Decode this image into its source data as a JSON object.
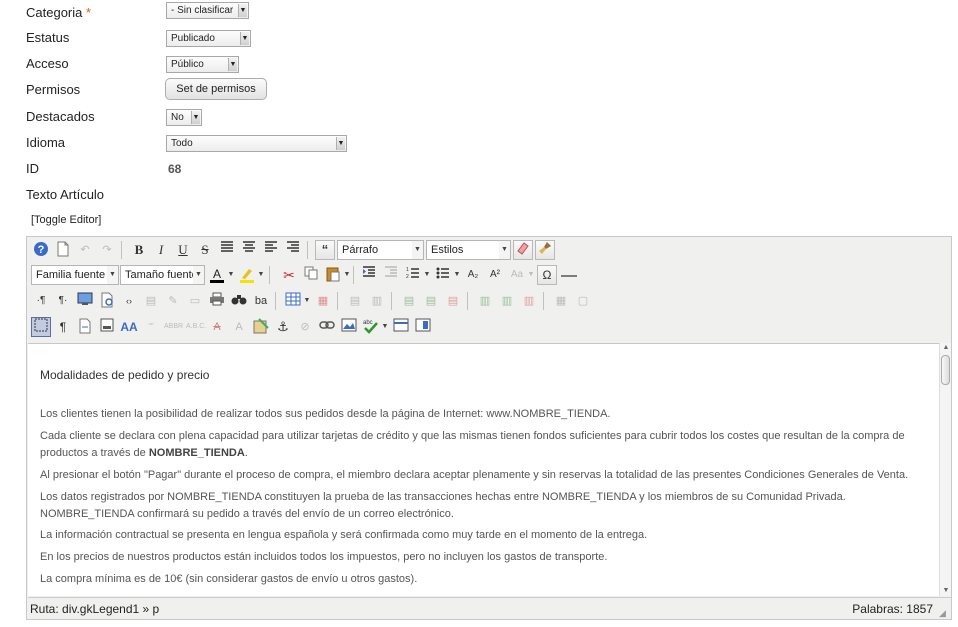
{
  "form": {
    "categoria_label": "Categoria",
    "categoria_required": "*",
    "categoria_value": "- Sin clasificar",
    "estatus_label": "Estatus",
    "estatus_value": "Publicado",
    "acceso_label": "Acceso",
    "acceso_value": "Público",
    "permisos_label": "Permisos",
    "permisos_button": "Set de permisos",
    "destacados_label": "Destacados",
    "destacados_value": "No",
    "idioma_label": "Idioma",
    "idioma_value": "Todo",
    "id_label": "ID",
    "id_value": "68",
    "texto_label": "Texto Artículo"
  },
  "toggle_editor": "[Toggle Editor]",
  "toolbar": {
    "bold": "B",
    "italic": "I",
    "underline": "U",
    "strike": "S",
    "format_select": "Párrafo",
    "styles_select": "Estilos",
    "font_family": "Familia fuente",
    "font_size": "Tamaño fuente",
    "omega": "Ω"
  },
  "icons": [
    "help-icon",
    "new-document-icon",
    "undo-icon",
    "redo-icon",
    "bold-icon",
    "italic-icon",
    "underline-icon",
    "strikethrough-icon",
    "align-justify-icon",
    "align-center-icon",
    "align-left-icon",
    "align-right-icon",
    "blockquote-icon",
    "eraser-icon",
    "cleanup-brush-icon",
    "font-color-icon",
    "highlight-icon",
    "cut-icon",
    "copy-icon",
    "paste-icon",
    "indent-icon",
    "outdent-icon",
    "ordered-list-icon",
    "unordered-list-icon",
    "subscript-icon",
    "superscript-icon",
    "special-char-icon",
    "horizontal-rule-icon",
    "ltr-icon",
    "rtl-icon",
    "fullscreen-icon",
    "preview-icon",
    "code-icon",
    "print-icon",
    "search-binoculars-icon",
    "replace-icon",
    "insert-table-icon",
    "anchor-icon",
    "link-icon",
    "image-icon",
    "spellcheck-icon",
    "show-blocks-icon",
    "visual-chars-icon"
  ],
  "colors": {
    "accent": "#c2cbe0",
    "help_icon": "#3b6bc8",
    "paste_icon": "#c98a2b",
    "cut_icon": "#cc2222",
    "spell_check": "#2a9a2a"
  },
  "content": {
    "heading": "Modalidades de pedido y precio",
    "p1": "Los clientes tienen la posibilidad de realizar todos sus pedidos desde la página de Internet: www.NOMBRE_TIENDA.",
    "p2_a": "Cada cliente se declara con plena capacidad para utilizar tarjetas de crédito y que las mismas tienen fondos suficientes para cubrir todos los costes que resultan de la compra de productos a través de ",
    "p2_b": "NOMBRE_TIENDA",
    "p2_c": ".",
    "p3": "Al presionar el botón \"Pagar\" durante el proceso de compra, el miembro declara aceptar plenamente y sin reservas la totalidad de las presentes Condiciones Generales de Venta.",
    "p4": "Los datos registrados por NOMBRE_TIENDA constituyen la prueba de las transacciones hechas entre NOMBRE_TIENDA y los miembros de su Comunidad Privada. NOMBRE_TIENDA confirmará su pedido a través del envío de un correo electrónico.",
    "p5": "La información contractual se presenta en lengua española y será confirmada como muy tarde en el momento de la entrega.",
    "p6": "En los precios de nuestros productos están incluidos todos los impuestos, pero no incluyen los gastos de transporte.",
    "p7": "La compra mínima es de 10€ (sin considerar gastos de envío u otros gastos)."
  },
  "statusbar": {
    "path": "Ruta: div.gkLegend1 » p",
    "words": "Palabras: 1857"
  }
}
